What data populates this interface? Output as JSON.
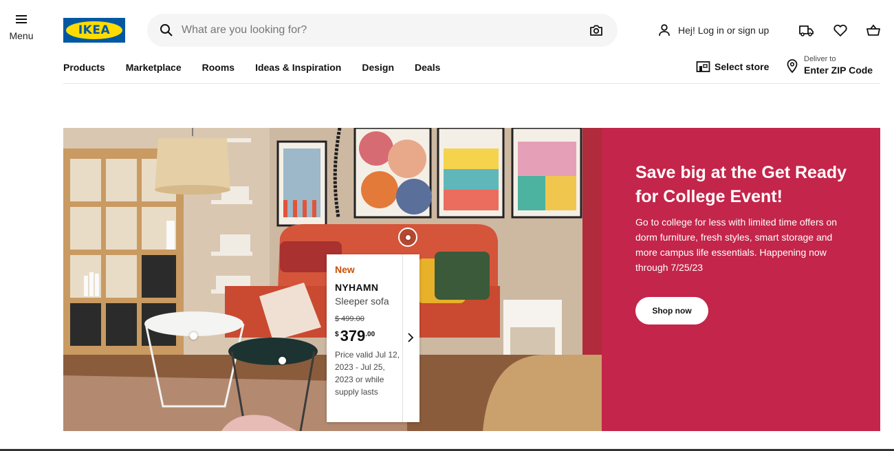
{
  "header": {
    "menu_label": "Menu",
    "logo_text": "IKEA",
    "search_placeholder": "What are you looking for?",
    "login_label": "Hej! Log in or sign up",
    "icons": [
      "hamburger-icon",
      "search-icon",
      "camera-icon",
      "user-icon",
      "truck-icon",
      "heart-icon",
      "basket-icon",
      "store-icon",
      "location-pin-icon",
      "chevron-right-icon"
    ]
  },
  "nav": {
    "items": [
      "Products",
      "Marketplace",
      "Rooms",
      "Ideas & Inspiration",
      "Design",
      "Deals"
    ],
    "store_label": "Select store",
    "deliver_to": "Deliver to",
    "zip_label": "Enter ZIP Code"
  },
  "product_card": {
    "badge": "New",
    "name": "NYHAMN",
    "description": "Sleeper sofa",
    "old_price": "$ 499.00",
    "currency": "$",
    "price_int": "379",
    "price_dec": ".00",
    "valid_text": "Price valid Jul 12, 2023 - Jul 25, 2023 or while supply lasts"
  },
  "promo": {
    "title": "Save big at the Get Ready for College Event!",
    "body": "Go to college for less with limited time offers on dorm furniture, fresh styles, smart storage and more campus life essentials. Happening now through 7/25/23",
    "button": "Shop now"
  },
  "colors": {
    "brand_blue": "#0058a3",
    "brand_yellow": "#ffdb00",
    "promo_bg": "#c4254a",
    "new_badge": "#ca5008"
  }
}
